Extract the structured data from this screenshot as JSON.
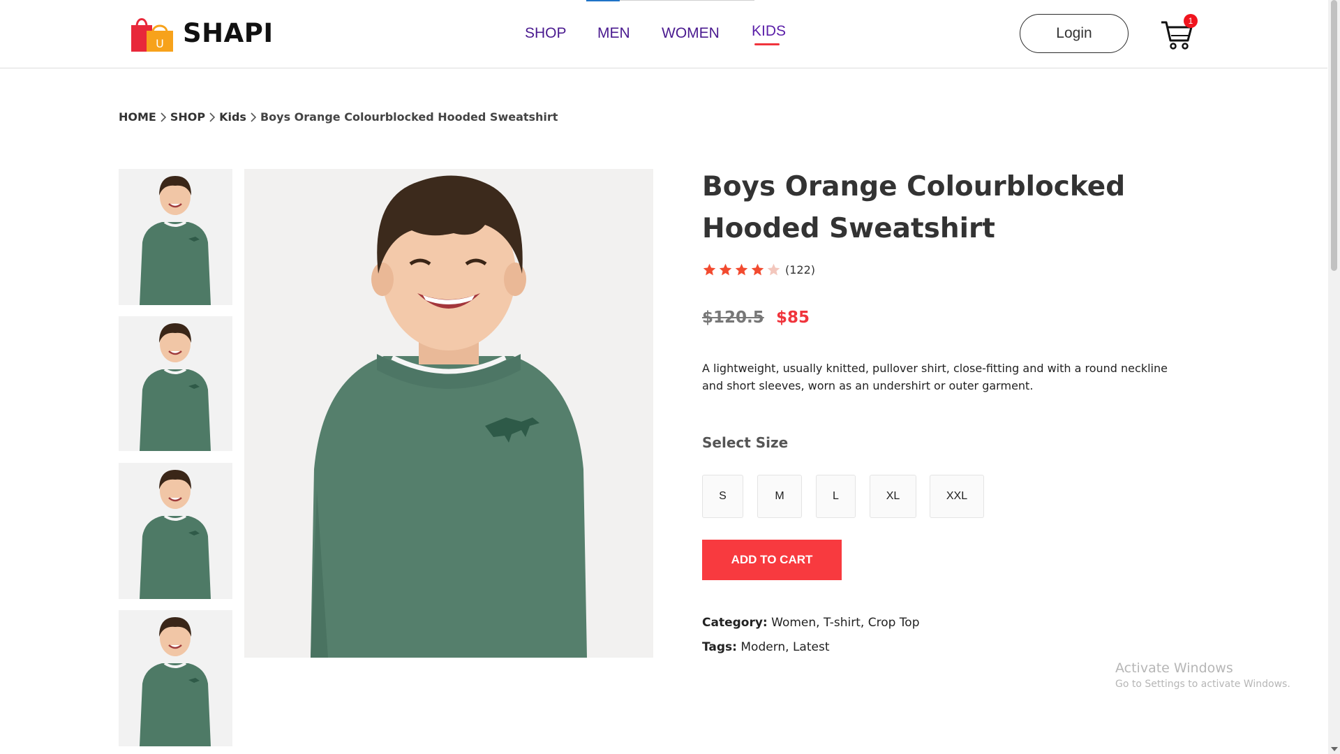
{
  "header": {
    "brand": "SHAPI",
    "logo_letter": "U",
    "nav": [
      {
        "label": "SHOP",
        "active": false
      },
      {
        "label": "MEN",
        "active": false
      },
      {
        "label": "WOMEN",
        "active": false
      },
      {
        "label": "KIDS",
        "active": true
      }
    ],
    "login_label": "Login",
    "cart_count": "1",
    "accent_color": "#f0343c",
    "nav_color": "#4a1a8f"
  },
  "breadcrumb": [
    "HOME",
    "SHOP",
    "Kids",
    "Boys Orange Colourblocked Hooded Sweatshirt"
  ],
  "gallery": {
    "thumbnail_count": 4,
    "image_subject": "smiling boy in green sweatshirt with dinosaur emblem"
  },
  "product": {
    "title_line1": "Boys Orange Colourblocked",
    "title_line2": "Hooded Sweatshirt",
    "rating": 4,
    "rating_max": 5,
    "review_count": "(122)",
    "old_price": "$120.5",
    "price": "$85",
    "description": "A lightweight, usually knitted, pullover shirt, close-fitting and with a round neckline and short sleeves, worn as an undershirt or outer garment.",
    "size_label": "Select Size",
    "sizes": [
      "S",
      "M",
      "L",
      "XL",
      "XXL"
    ],
    "add_to_cart_label": "ADD TO CART",
    "category_label": "Category:",
    "category_value": "Women, T-shirt, Crop Top",
    "tags_label": "Tags:",
    "tags_value": "Modern, Latest"
  },
  "watermark": {
    "line1": "Activate Windows",
    "line2": "Go to Settings to activate Windows."
  }
}
